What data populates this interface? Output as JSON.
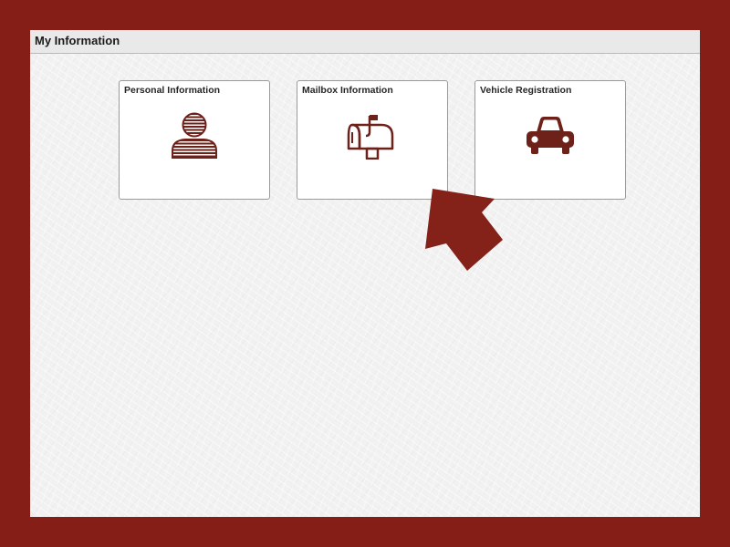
{
  "page": {
    "title": "My Information"
  },
  "tiles": [
    {
      "label": "Personal Information",
      "icon": "person-icon"
    },
    {
      "label": "Mailbox Information",
      "icon": "mailbox-icon"
    },
    {
      "label": "Vehicle Registration",
      "icon": "car-icon"
    }
  ],
  "colors": {
    "frame": "#841e16",
    "icon": "#6e2119",
    "arrow": "#842219",
    "background": "#f1f1f1"
  }
}
